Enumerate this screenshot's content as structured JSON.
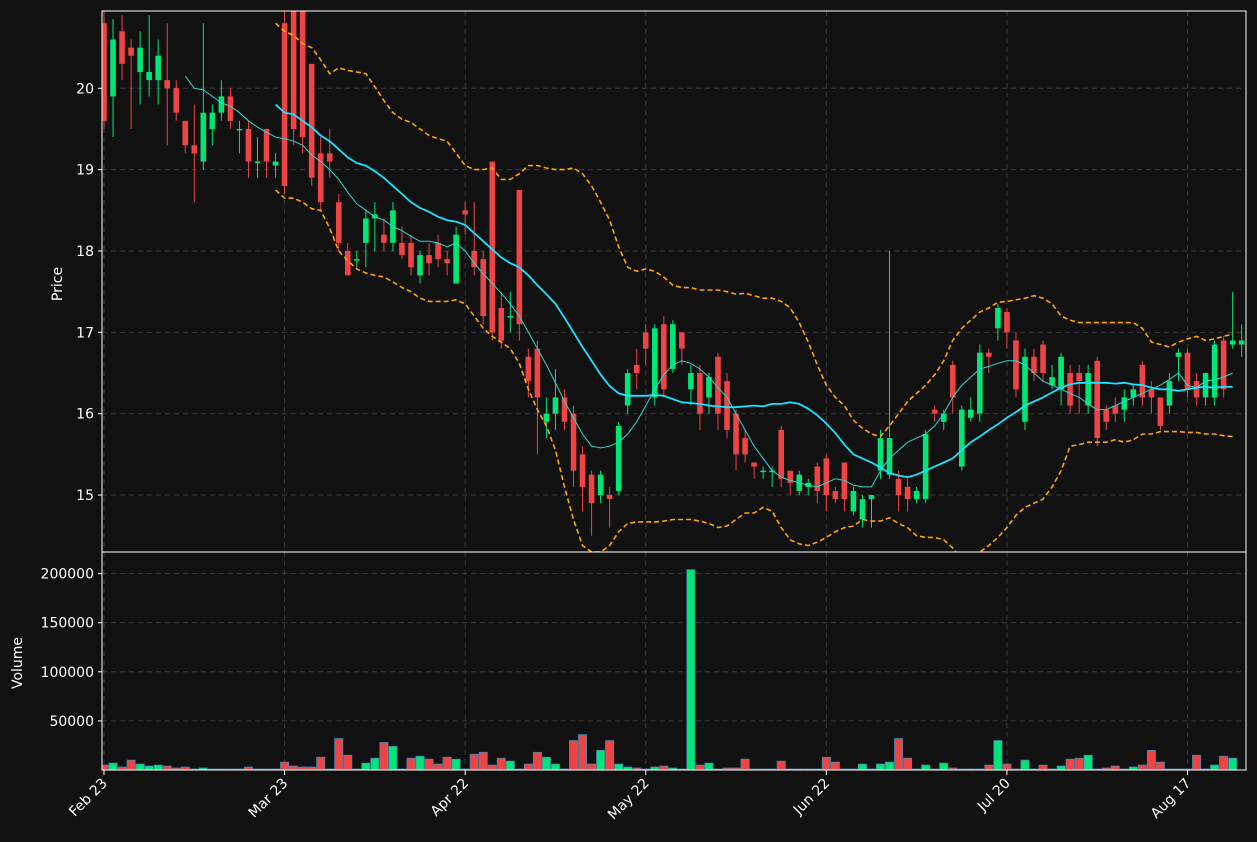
{
  "chart_data": {
    "type": "candlestick",
    "title": "",
    "colors": {
      "background": "#111111",
      "up": "#00e676",
      "down": "#ef4444",
      "ma_slow": "#18e4ff",
      "ma_fast": "#2fd6d0",
      "bollinger": "#ffa500",
      "grid": "#3a3a3a",
      "axis": "#ffffff"
    },
    "price_panel": {
      "ylabel": "Price",
      "ylim": [
        14.3,
        20.95
      ],
      "yticks": [
        15,
        16,
        17,
        18,
        19,
        20
      ],
      "grid": true,
      "upper_band_style": "dashed",
      "lower_band_style": "dashed"
    },
    "volume_panel": {
      "ylabel": "Volume",
      "ylim": [
        0,
        222000
      ],
      "yticks": [
        50000,
        100000,
        150000,
        200000
      ],
      "grid": true
    },
    "x_ticks": [
      {
        "label": "Feb 23",
        "index": 0
      },
      {
        "label": "Mar 23",
        "index": 20
      },
      {
        "label": "Apr 22",
        "index": 40
      },
      {
        "label": "May 22",
        "index": 60
      },
      {
        "label": "Jun 22",
        "index": 80
      },
      {
        "label": "Jul 20",
        "index": 100
      },
      {
        "label": "Aug 17",
        "index": 120
      }
    ],
    "candles": [
      [
        20.8,
        19.6,
        20.95,
        19.5
      ],
      [
        19.9,
        20.6,
        20.85,
        19.4
      ],
      [
        20.7,
        20.3,
        20.9,
        20.1
      ],
      [
        20.5,
        20.4,
        20.6,
        19.5
      ],
      [
        20.2,
        20.5,
        20.7,
        19.8
      ],
      [
        20.1,
        20.2,
        20.9,
        19.9
      ],
      [
        20.1,
        20.4,
        20.6,
        19.8
      ],
      [
        20.1,
        20.0,
        20.8,
        19.3
      ],
      [
        20.0,
        19.7,
        20.1,
        19.6
      ],
      [
        19.6,
        19.3,
        19.6,
        19.2
      ],
      [
        19.3,
        19.2,
        19.8,
        18.6
      ],
      [
        19.1,
        19.7,
        20.8,
        19.0
      ],
      [
        19.5,
        19.7,
        19.8,
        19.3
      ],
      [
        19.7,
        19.9,
        20.1,
        19.6
      ],
      [
        19.9,
        19.6,
        20.0,
        19.5
      ],
      [
        19.5,
        19.5,
        19.6,
        19.2
      ],
      [
        19.5,
        19.1,
        19.6,
        18.9
      ],
      [
        19.1,
        19.1,
        19.4,
        18.9
      ],
      [
        19.5,
        19.1,
        19.5,
        18.9
      ],
      [
        19.05,
        19.1,
        19.2,
        18.9
      ],
      [
        20.8,
        18.8,
        20.95,
        18.7
      ],
      [
        20.95,
        19.5,
        20.95,
        19.3
      ],
      [
        20.95,
        19.4,
        20.95,
        19.2
      ],
      [
        20.3,
        18.9,
        20.3,
        18.8
      ],
      [
        19.2,
        18.6,
        19.4,
        18.5
      ],
      [
        19.2,
        19.1,
        19.5,
        18.9
      ],
      [
        18.6,
        18.1,
        18.7,
        18.0
      ],
      [
        18.0,
        17.7,
        18.1,
        17.7
      ],
      [
        17.9,
        17.9,
        18.0,
        17.8
      ],
      [
        18.1,
        18.4,
        18.5,
        17.8
      ],
      [
        18.4,
        18.45,
        18.6,
        18.0
      ],
      [
        18.2,
        18.1,
        18.4,
        18.0
      ],
      [
        18.1,
        18.5,
        18.6,
        18.0
      ],
      [
        18.1,
        17.95,
        18.3,
        17.9
      ],
      [
        18.1,
        17.8,
        18.2,
        17.7
      ],
      [
        17.7,
        17.95,
        18.0,
        17.6
      ],
      [
        17.95,
        17.85,
        18.1,
        17.7
      ],
      [
        18.1,
        17.9,
        18.2,
        17.8
      ],
      [
        17.9,
        17.85,
        18.0,
        17.7
      ],
      [
        17.6,
        18.2,
        18.3,
        17.6
      ],
      [
        18.5,
        18.45,
        18.6,
        18.2
      ],
      [
        18.0,
        17.8,
        18.6,
        17.7
      ],
      [
        17.9,
        17.2,
        18.0,
        17.1
      ],
      [
        19.1,
        17.0,
        19.1,
        16.9
      ],
      [
        17.3,
        16.9,
        17.5,
        16.8
      ],
      [
        17.2,
        17.2,
        17.5,
        17.0
      ],
      [
        18.75,
        17.1,
        18.75,
        16.9
      ],
      [
        16.7,
        16.4,
        16.8,
        16.2
      ],
      [
        16.8,
        16.2,
        16.9,
        15.5
      ],
      [
        15.9,
        16.0,
        16.2,
        15.7
      ],
      [
        16.0,
        16.2,
        16.55,
        15.8
      ],
      [
        16.2,
        15.9,
        16.3,
        15.8
      ],
      [
        16.0,
        15.3,
        16.1,
        15.1
      ],
      [
        15.5,
        15.1,
        15.6,
        14.8
      ],
      [
        15.25,
        14.9,
        15.3,
        14.5
      ],
      [
        15.0,
        15.25,
        15.3,
        14.9
      ],
      [
        15.0,
        14.95,
        15.1,
        14.6
      ],
      [
        15.05,
        15.85,
        15.9,
        15.0
      ],
      [
        16.1,
        16.5,
        16.55,
        16.0
      ],
      [
        16.6,
        16.5,
        16.8,
        16.3
      ],
      [
        17.0,
        16.8,
        17.1,
        16.6
      ],
      [
        16.2,
        17.05,
        17.1,
        16.1
      ],
      [
        17.1,
        16.3,
        17.2,
        16.2
      ],
      [
        16.55,
        17.1,
        17.15,
        16.5
      ],
      [
        17.0,
        16.8,
        17.0,
        16.6
      ],
      [
        16.3,
        16.5,
        16.6,
        16.1
      ],
      [
        16.5,
        16.0,
        16.6,
        15.8
      ],
      [
        16.2,
        16.45,
        16.5,
        16.0
      ],
      [
        16.7,
        16.0,
        16.75,
        15.8
      ],
      [
        16.4,
        15.8,
        16.5,
        15.7
      ],
      [
        16.0,
        15.5,
        16.05,
        15.3
      ],
      [
        15.7,
        15.5,
        15.8,
        15.4
      ],
      [
        15.4,
        15.35,
        15.4,
        15.2
      ],
      [
        15.3,
        15.3,
        15.35,
        15.2
      ],
      [
        15.3,
        15.3,
        15.35,
        15.1
      ],
      [
        15.8,
        15.2,
        15.85,
        15.1
      ],
      [
        15.3,
        15.15,
        15.3,
        15.0
      ],
      [
        15.05,
        15.25,
        15.3,
        15.0
      ],
      [
        15.1,
        15.15,
        15.2,
        15.0
      ],
      [
        15.35,
        15.05,
        15.4,
        14.9
      ],
      [
        15.45,
        15.0,
        15.5,
        14.8
      ],
      [
        15.05,
        14.95,
        15.1,
        14.9
      ],
      [
        15.4,
        14.95,
        15.4,
        14.8
      ],
      [
        14.8,
        15.05,
        15.1,
        14.75
      ],
      [
        14.7,
        14.95,
        15.0,
        14.6
      ],
      [
        14.95,
        15.0,
        15.0,
        14.6
      ],
      [
        15.3,
        15.7,
        15.8,
        15.2
      ],
      [
        15.25,
        15.7,
        18.0,
        15.2
      ],
      [
        15.2,
        15.0,
        15.3,
        14.8
      ],
      [
        15.1,
        14.95,
        15.2,
        14.8
      ],
      [
        14.95,
        15.05,
        15.1,
        14.9
      ],
      [
        14.95,
        15.75,
        15.8,
        14.9
      ],
      [
        16.05,
        16.0,
        16.1,
        15.9
      ],
      [
        15.9,
        16.0,
        16.05,
        15.8
      ],
      [
        16.6,
        16.2,
        16.65,
        16.0
      ],
      [
        15.35,
        16.05,
        16.1,
        15.3
      ],
      [
        15.95,
        16.05,
        16.2,
        15.9
      ],
      [
        16.0,
        16.75,
        16.85,
        15.9
      ],
      [
        16.75,
        16.7,
        16.8,
        16.5
      ],
      [
        17.05,
        17.3,
        17.35,
        16.9
      ],
      [
        17.25,
        17.0,
        17.3,
        16.8
      ],
      [
        16.9,
        16.3,
        17.0,
        16.2
      ],
      [
        15.9,
        16.7,
        16.8,
        15.8
      ],
      [
        16.7,
        16.5,
        16.8,
        16.4
      ],
      [
        16.85,
        16.5,
        16.9,
        16.4
      ],
      [
        16.35,
        16.45,
        16.6,
        16.3
      ],
      [
        16.3,
        16.7,
        16.75,
        16.1
      ],
      [
        16.5,
        16.1,
        16.6,
        16.0
      ],
      [
        16.5,
        16.4,
        16.6,
        16.0
      ],
      [
        16.1,
        16.5,
        16.6,
        16.0
      ],
      [
        16.65,
        15.7,
        16.7,
        15.6
      ],
      [
        16.05,
        15.9,
        16.1,
        15.8
      ],
      [
        16.1,
        16.0,
        16.2,
        15.9
      ],
      [
        16.05,
        16.2,
        16.3,
        15.9
      ],
      [
        16.2,
        16.3,
        16.35,
        16.1
      ],
      [
        16.6,
        16.2,
        16.65,
        16.1
      ],
      [
        16.3,
        16.2,
        16.4,
        16.0
      ],
      [
        16.2,
        15.85,
        16.2,
        15.8
      ],
      [
        16.1,
        16.4,
        16.5,
        16.0
      ],
      [
        16.7,
        16.75,
        16.8,
        16.4
      ],
      [
        16.75,
        16.3,
        16.8,
        16.2
      ],
      [
        16.4,
        16.2,
        16.5,
        16.1
      ],
      [
        16.2,
        16.5,
        16.5,
        16.1
      ],
      [
        16.2,
        16.85,
        16.9,
        16.1
      ],
      [
        16.9,
        16.3,
        16.95,
        16.2
      ],
      [
        16.85,
        16.9,
        17.5,
        16.8
      ],
      [
        16.85,
        16.9,
        17.1,
        16.7
      ]
    ],
    "volumes": [
      5000,
      7000,
      3000,
      10000,
      6000,
      4000,
      5000,
      4000,
      2000,
      3000,
      1000,
      2000,
      1000,
      1000,
      1000,
      1000,
      3000,
      1000,
      1000,
      1000,
      8000,
      4000,
      3000,
      3000,
      13000,
      1000,
      32000,
      15000,
      1000,
      7000,
      12000,
      28000,
      24000,
      1000,
      12000,
      14000,
      11000,
      6000,
      13000,
      11000,
      1000,
      16000,
      18000,
      5000,
      12000,
      9000,
      1000,
      6000,
      18000,
      13000,
      6000,
      1000,
      30000,
      36000,
      6000,
      20000,
      30000,
      6000,
      3000,
      2000,
      1000,
      3000,
      4000,
      2000,
      1000,
      204000,
      5000,
      7000,
      1000,
      2000,
      2000,
      11000,
      1000,
      1000,
      1000,
      9000,
      1000,
      1000,
      1000,
      1000,
      13000,
      8000,
      1000,
      1000,
      6000,
      1000,
      6000,
      8000,
      32000,
      12000,
      1000,
      5000,
      1000,
      7000,
      2000,
      1000,
      1000,
      1000,
      5000,
      30000,
      6000,
      1000,
      10000,
      1000,
      5000,
      1000,
      4000,
      11000,
      12000,
      15000,
      1000,
      2000,
      4000,
      1000,
      3000,
      5000,
      20000,
      8000,
      1000,
      1000,
      1000,
      15000,
      1000,
      5000,
      14000,
      12000
    ],
    "ma_slow": [
      null,
      null,
      null,
      null,
      null,
      null,
      null,
      null,
      null,
      null,
      null,
      null,
      null,
      null,
      null,
      null,
      null,
      null,
      null,
      19.8,
      19.7,
      19.68,
      19.6,
      19.52,
      19.42,
      19.35,
      19.25,
      19.15,
      19.08,
      19.05,
      18.98,
      18.9,
      18.8,
      18.7,
      18.6,
      18.53,
      18.48,
      18.42,
      18.38,
      18.36,
      18.32,
      18.22,
      18.12,
      18.02,
      17.92,
      17.85,
      17.8,
      17.7,
      17.58,
      17.47,
      17.35,
      17.18,
      17.0,
      16.82,
      16.65,
      16.48,
      16.34,
      16.25,
      16.22,
      16.22,
      16.22,
      16.23,
      16.22,
      16.18,
      16.14,
      16.13,
      16.12,
      16.1,
      16.09,
      16.08,
      16.08,
      16.09,
      16.1,
      16.09,
      16.12,
      16.12,
      16.14,
      16.12,
      16.06,
      15.98,
      15.88,
      15.76,
      15.62,
      15.5,
      15.45,
      15.4,
      15.34,
      15.27,
      15.24,
      15.22,
      15.25,
      15.3,
      15.35,
      15.4,
      15.45,
      15.55,
      15.65,
      15.72,
      15.8,
      15.87,
      15.95,
      16.02,
      16.1,
      16.15,
      16.2,
      16.26,
      16.32,
      16.36,
      16.38,
      16.38,
      16.38,
      16.38,
      16.37,
      16.38,
      16.36,
      16.35,
      16.32,
      16.3,
      16.3,
      16.28,
      16.3,
      16.32,
      16.33,
      16.32,
      16.33,
      16.33
    ],
    "ma_fast": [
      null,
      null,
      null,
      null,
      null,
      null,
      null,
      null,
      null,
      20.15,
      20.0,
      19.98,
      19.9,
      19.82,
      19.78,
      19.7,
      19.6,
      19.52,
      19.46,
      19.4,
      19.38,
      19.35,
      19.3,
      19.18,
      19.1,
      19.0,
      18.88,
      18.72,
      18.58,
      18.5,
      18.42,
      18.38,
      18.3,
      18.25,
      18.18,
      18.12,
      18.12,
      18.1,
      18.05,
      18.1,
      18.0,
      17.85,
      17.72,
      17.6,
      17.48,
      17.35,
      17.2,
      17.0,
      16.8,
      16.6,
      16.38,
      16.15,
      15.95,
      15.75,
      15.6,
      15.58,
      15.6,
      15.65,
      15.75,
      15.9,
      16.1,
      16.3,
      16.48,
      16.6,
      16.65,
      16.62,
      16.55,
      16.45,
      16.32,
      16.2,
      16.0,
      15.8,
      15.6,
      15.45,
      15.3,
      15.22,
      15.18,
      15.15,
      15.12,
      15.1,
      15.15,
      15.2,
      15.18,
      15.12,
      15.1,
      15.1,
      15.3,
      15.45,
      15.55,
      15.65,
      15.7,
      15.75,
      15.85,
      16.0,
      16.2,
      16.35,
      16.45,
      16.55,
      16.58,
      16.62,
      16.65,
      16.65,
      16.6,
      16.5,
      16.4,
      16.35,
      16.3,
      16.25,
      16.2,
      16.12,
      16.05,
      16.05,
      16.1,
      16.15,
      16.2,
      16.25,
      16.3,
      16.35,
      16.42,
      16.5,
      16.35,
      16.32,
      16.4,
      16.42,
      16.45,
      16.5
    ],
    "bb_upper": [
      null,
      null,
      null,
      null,
      null,
      null,
      null,
      null,
      null,
      null,
      null,
      null,
      null,
      null,
      null,
      null,
      null,
      null,
      null,
      20.8,
      20.7,
      20.65,
      20.55,
      20.5,
      20.35,
      20.18,
      20.25,
      20.22,
      20.2,
      20.18,
      20.02,
      19.85,
      19.7,
      19.62,
      19.58,
      19.5,
      19.42,
      19.38,
      19.35,
      19.2,
      19.05,
      19.0,
      19.0,
      19.02,
      18.88,
      18.88,
      18.95,
      19.05,
      19.05,
      19.02,
      19.0,
      19.0,
      19.02,
      18.95,
      18.8,
      18.6,
      18.38,
      18.05,
      17.8,
      17.75,
      17.78,
      17.75,
      17.68,
      17.58,
      17.55,
      17.55,
      17.52,
      17.52,
      17.52,
      17.5,
      17.47,
      17.48,
      17.45,
      17.42,
      17.42,
      17.38,
      17.3,
      17.12,
      16.88,
      16.6,
      16.35,
      16.2,
      16.1,
      15.92,
      15.82,
      15.75,
      15.72,
      15.85,
      16.0,
      16.15,
      16.25,
      16.35,
      16.48,
      16.65,
      16.9,
      17.05,
      17.15,
      17.25,
      17.3,
      17.37,
      17.38,
      17.4,
      17.42,
      17.45,
      17.42,
      17.35,
      17.2,
      17.15,
      17.12,
      17.12,
      17.12,
      17.12,
      17.12,
      17.12,
      17.12,
      17.05,
      16.88,
      16.85,
      16.82,
      16.88,
      16.92,
      16.95,
      16.9,
      16.92,
      16.95,
      16.98
    ],
    "bb_lower": [
      null,
      null,
      null,
      null,
      null,
      null,
      null,
      null,
      null,
      null,
      null,
      null,
      null,
      null,
      null,
      null,
      null,
      null,
      null,
      18.75,
      18.65,
      18.65,
      18.6,
      18.52,
      18.5,
      18.28,
      18.0,
      17.88,
      17.78,
      17.73,
      17.7,
      17.68,
      17.62,
      17.55,
      17.5,
      17.42,
      17.38,
      17.38,
      17.38,
      17.4,
      17.35,
      17.2,
      17.05,
      16.95,
      16.88,
      16.8,
      16.62,
      16.3,
      16.05,
      15.85,
      15.55,
      15.1,
      14.7,
      14.38,
      14.3,
      14.3,
      14.38,
      14.55,
      14.65,
      14.67,
      14.67,
      14.67,
      14.68,
      14.7,
      14.7,
      14.7,
      14.68,
      14.65,
      14.6,
      14.62,
      14.7,
      14.78,
      14.78,
      14.85,
      14.8,
      14.6,
      14.45,
      14.4,
      14.38,
      14.42,
      14.48,
      14.55,
      14.6,
      14.62,
      14.7,
      14.68,
      14.68,
      14.72,
      14.65,
      14.6,
      14.5,
      14.48,
      14.48,
      14.45,
      14.35,
      14.2,
      14.25,
      14.3,
      14.38,
      14.48,
      14.6,
      14.75,
      14.85,
      14.9,
      14.95,
      15.1,
      15.3,
      15.6,
      15.62,
      15.65,
      15.65,
      15.65,
      15.68,
      15.65,
      15.68,
      15.75,
      15.75,
      15.78,
      15.78,
      15.78,
      15.77,
      15.77,
      15.75,
      15.75,
      15.73,
      15.72
    ]
  }
}
